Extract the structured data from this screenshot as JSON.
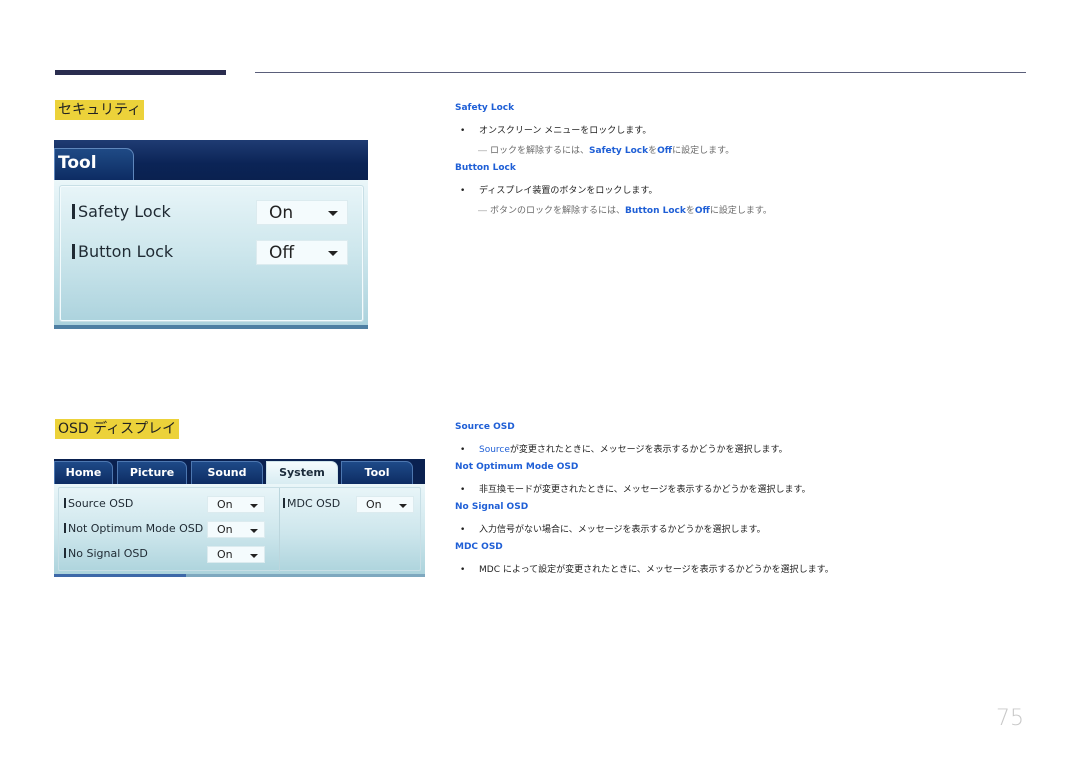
{
  "sections": {
    "security": {
      "heading": "セキュリティ",
      "panel": {
        "tab": "Tool",
        "rows": [
          {
            "label": "Safety Lock",
            "value": "On"
          },
          {
            "label": "Button Lock",
            "value": "Off"
          }
        ]
      },
      "items": [
        {
          "term": "Safety Lock",
          "bullet": "オンスクリーン メニューをロックします。",
          "note": {
            "prefix": "ロックを解除するには、",
            "term": "Safety Lock",
            "mid": "を",
            "value": "Off",
            "suffix": "に設定します。"
          }
        },
        {
          "term": "Button Lock",
          "bullet": "ディスプレイ装置のボタンをロックします。",
          "note": {
            "prefix": "ボタンのロックを解除するには、",
            "term": "Button Lock",
            "mid": "を",
            "value": "Off",
            "suffix": "に設定します。"
          }
        }
      ]
    },
    "osd": {
      "heading": "OSD ディスプレイ",
      "panel": {
        "tabs": [
          "Home",
          "Picture",
          "Sound",
          "System",
          "Tool"
        ],
        "active_tab": "System",
        "rows": [
          {
            "label": "Source OSD",
            "value": "On"
          },
          {
            "label": "Not Optimum Mode OSD",
            "value": "On"
          },
          {
            "label": "No Signal OSD",
            "value": "On"
          },
          {
            "label": "MDC OSD",
            "value": "On"
          }
        ]
      },
      "items": [
        {
          "term": "Source OSD",
          "bullet_term": "Source",
          "bullet": "が変更されたときに、メッセージを表示するかどうかを選択します。"
        },
        {
          "term": "Not Optimum Mode OSD",
          "bullet": "非互換モードが変更されたときに、メッセージを表示するかどうかを選択します。"
        },
        {
          "term": "No Signal OSD",
          "bullet": "入力信号がない場合に、メッセージを表示するかどうかを選択します。"
        },
        {
          "term": "MDC OSD",
          "bullet": "MDC によって設定が変更されたときに、メッセージを表示するかどうかを選択します。"
        }
      ]
    }
  },
  "symbols": {
    "bullet": "•",
    "note_dash": "―"
  },
  "page_number": "75",
  "colors": {
    "heading_highlight": "#ecd23a",
    "term_blue": "#1f5fd6",
    "panel_navy": "#0a2150"
  }
}
